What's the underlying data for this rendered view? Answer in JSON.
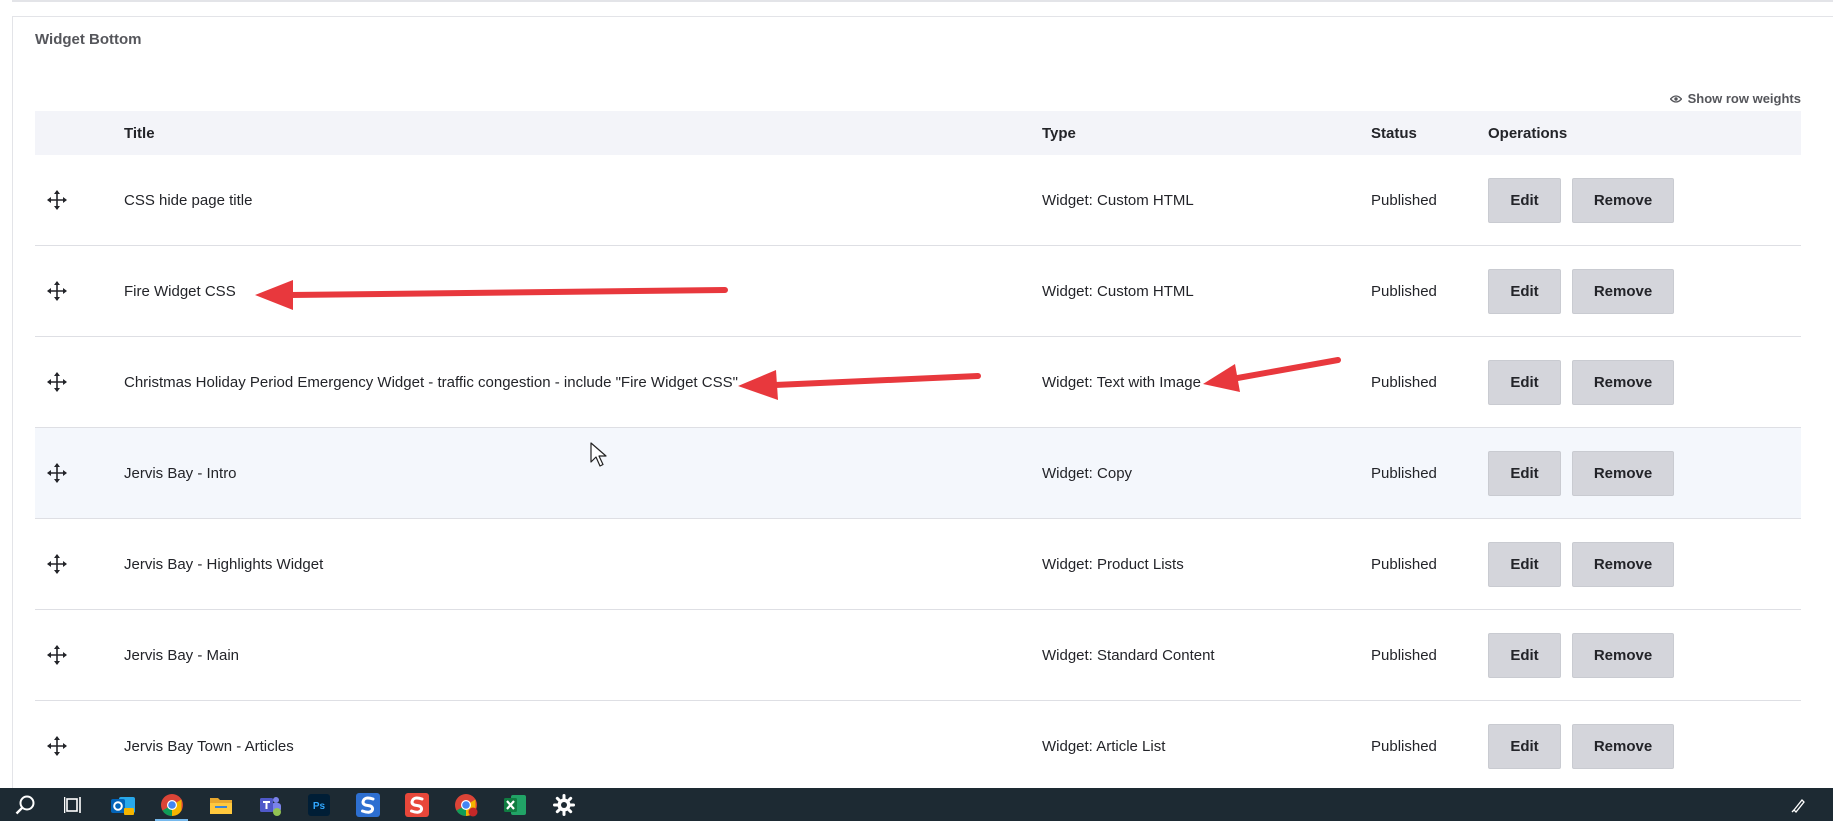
{
  "panel": {
    "title": "Widget Bottom",
    "show_row_weights": "Show row weights"
  },
  "table": {
    "headers": {
      "title": "Title",
      "type": "Type",
      "status": "Status",
      "operations": "Operations"
    },
    "edit_label": "Edit",
    "remove_label": "Remove",
    "rows": [
      {
        "title": "CSS hide page title",
        "type": "Widget: Custom HTML",
        "status": "Published"
      },
      {
        "title": "Fire Widget CSS",
        "type": "Widget: Custom HTML",
        "status": "Published"
      },
      {
        "title": "Christmas Holiday Period Emergency Widget - traffic congestion - include \"Fire Widget CSS\"",
        "type": "Widget: Text with Image",
        "status": "Published"
      },
      {
        "title": "Jervis Bay - Intro",
        "type": "Widget: Copy",
        "status": "Published"
      },
      {
        "title": "Jervis Bay - Highlights Widget",
        "type": "Widget: Product Lists",
        "status": "Published"
      },
      {
        "title": "Jervis Bay - Main",
        "type": "Widget: Standard Content",
        "status": "Published"
      },
      {
        "title": "Jervis Bay Town - Articles",
        "type": "Widget: Article List",
        "status": "Published"
      }
    ]
  },
  "annotations": {
    "arrow_color": "#e8383d"
  },
  "taskbar": {
    "items": [
      {
        "icon": "search-icon"
      },
      {
        "icon": "task-view-icon"
      },
      {
        "icon": "outlook-icon"
      },
      {
        "icon": "chrome-icon"
      },
      {
        "icon": "file-explorer-icon"
      },
      {
        "icon": "teams-icon"
      },
      {
        "icon": "photoshop-icon"
      },
      {
        "icon": "snagit-editor-icon"
      },
      {
        "icon": "snagit-icon"
      },
      {
        "icon": "chrome-profile-icon"
      },
      {
        "icon": "excel-icon"
      },
      {
        "icon": "settings-icon"
      }
    ]
  },
  "colors": {
    "header_bg": "#f3f4f9",
    "button_bg": "#d4d5db",
    "hover_row_bg": "#f4f7fc",
    "taskbar_bg": "#1d2a33"
  }
}
